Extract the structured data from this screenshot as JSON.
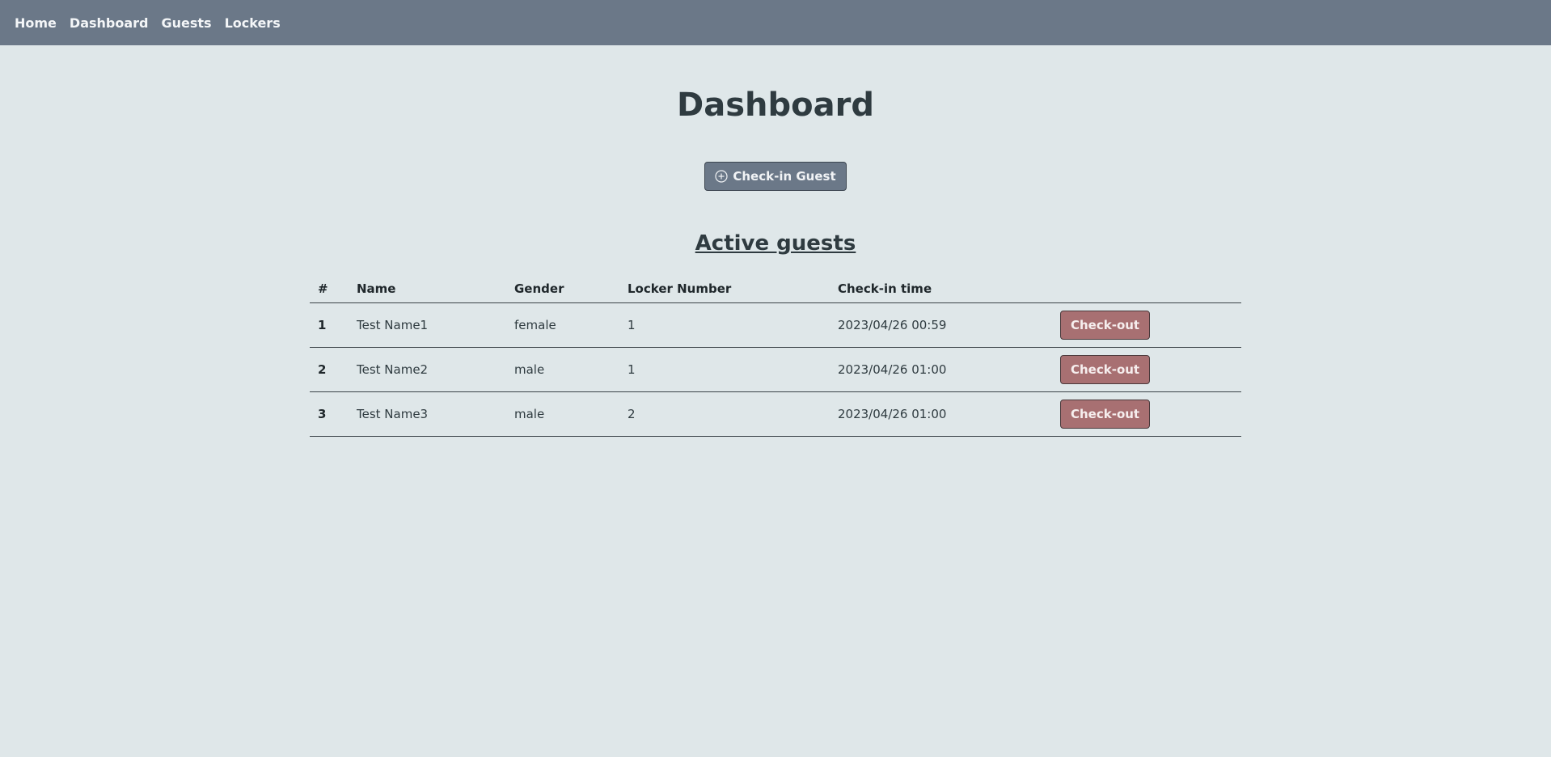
{
  "nav": {
    "items": [
      {
        "label": "Home"
      },
      {
        "label": "Dashboard"
      },
      {
        "label": "Guests"
      },
      {
        "label": "Lockers"
      }
    ]
  },
  "page": {
    "title": "Dashboard",
    "checkin_button_label": "Check-in Guest",
    "checkin_icon": "plus-circle-icon",
    "section_title": "Active guests"
  },
  "table": {
    "headers": [
      "#",
      "Name",
      "Gender",
      "Locker Number",
      "Check-in time",
      ""
    ],
    "rows": [
      {
        "num": "1",
        "name": "Test Name1",
        "gender": "female",
        "locker": "1",
        "checkin_time": "2023/04/26 00:59",
        "action": "Check-out"
      },
      {
        "num": "2",
        "name": "Test Name2",
        "gender": "male",
        "locker": "1",
        "checkin_time": "2023/04/26 01:00",
        "action": "Check-out"
      },
      {
        "num": "3",
        "name": "Test Name3",
        "gender": "male",
        "locker": "2",
        "checkin_time": "2023/04/26 01:00",
        "action": "Check-out"
      }
    ]
  },
  "colors": {
    "navbar": "#6b7888",
    "background": "#dfe7e9",
    "checkout_button": "#a87072",
    "checkin_button": "#6b7888"
  }
}
